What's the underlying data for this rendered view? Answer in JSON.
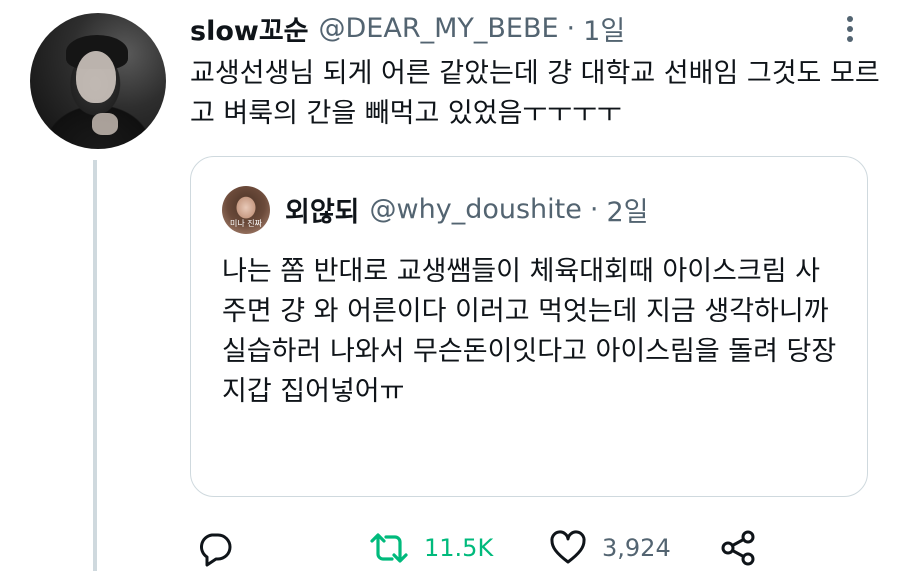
{
  "tweet": {
    "display_name": "slow꼬순",
    "handle": "@DEAR_MY_BEBE",
    "separator": "·",
    "time": "1일",
    "text": "교생선생님 되게 어른 같았는데 걍 대학교 선배임 그것도 모르고 벼룩의 간을 빼먹고 있었음ㅜㅜㅜㅜ",
    "avatar_icon": "profile-photo"
  },
  "quote": {
    "display_name": "외않되",
    "handle": "@why_doushite",
    "separator": "·",
    "time": "2일",
    "avatar_caption": "미나 진짜",
    "text": "나는 쫌 반대로 교생쌤들이 체육대회때 아이스크림 사주면 걍 와 어른이다 이러고 먹엇는데 지금 생각하니까 실습하러 나와서 무슨돈이잇다고 아이스림을 돌려 당장 지갑 집어넣어ㅠ"
  },
  "actions": {
    "reply_icon": "reply-icon",
    "retweet_icon": "retweet-icon",
    "retweet_count": "11.5K",
    "like_icon": "heart-icon",
    "like_count": "3,924",
    "share_icon": "share-icon"
  },
  "colors": {
    "text": "#0f1419",
    "secondary": "#536471",
    "border": "#cfd9de",
    "retweet_active": "#00ba7c"
  }
}
